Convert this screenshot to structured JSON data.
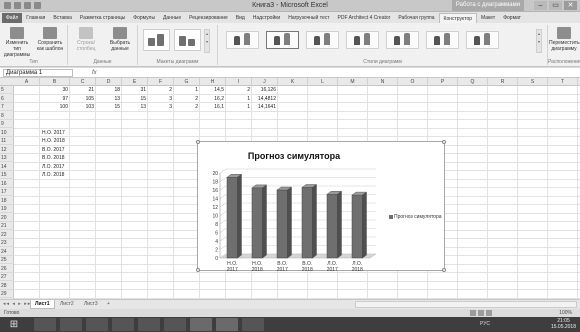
{
  "window": {
    "title": "Книга3 - Microsoft Excel",
    "context_title": "Работа с диаграммами",
    "controls": [
      "–",
      "▭",
      "✕"
    ]
  },
  "ribbon_tabs": [
    "Файл",
    "Главная",
    "Вставка",
    "Разметка страницы",
    "Формулы",
    "Данные",
    "Рецензирование",
    "Вид",
    "Надстройки",
    "Нагрузочный тест",
    "PDF Architect 4 Creator",
    "Рабочая группа",
    "Конструктор",
    "Макет",
    "Формат"
  ],
  "active_tab": "Конструктор",
  "ribbon": {
    "change_type": "Изменить тип диаграммы",
    "save_template": "Сохранить как шаблон",
    "type_group": "Тип",
    "row_col": "Строка/столбец",
    "select_data": "Выбрать данные",
    "data_group": "Данные",
    "layouts_group": "Макеты диаграмм",
    "styles_group": "Стили диаграмм",
    "move_chart": "Переместить диаграмму",
    "location_group": "Расположение"
  },
  "formula_bar": {
    "name_box": "Диаграмма 1",
    "fx": "fx",
    "content": ""
  },
  "columns": [
    "A",
    "B",
    "C",
    "D",
    "E",
    "F",
    "G",
    "H",
    "I",
    "J",
    "K",
    "L",
    "M",
    "N",
    "O",
    "P",
    "Q",
    "R",
    "S",
    "T",
    "U"
  ],
  "rows": [
    "5",
    "6",
    "7",
    "8",
    "9",
    "10",
    "11",
    "12",
    "13",
    "14",
    "15",
    "16",
    "17",
    "18",
    "19",
    "20",
    "21",
    "22",
    "23",
    "24",
    "25",
    "26",
    "27",
    "28",
    "29"
  ],
  "cells": {
    "r5": [
      "30",
      "21",
      "18",
      "31",
      "2",
      "1",
      "14,5",
      "2",
      "16,126"
    ],
    "r6": [
      "97",
      "105",
      "13",
      "15",
      "3",
      "2",
      "16,2",
      "1",
      "14,4812"
    ],
    "r7": [
      "100",
      "103",
      "15",
      "13",
      "3",
      "2",
      "16,1",
      "1",
      "14,1641"
    ],
    "b_labels": [
      "Н.О. 2017",
      "Н.О. 2018",
      "В.О. 2017",
      "В.О. 2018",
      "Л.О. 2017",
      "Л.О. 2018"
    ]
  },
  "chart_data": {
    "type": "bar",
    "title": "Прогноз симулятора",
    "categories": [
      "Н.О. 2017",
      "Н.О. 2018",
      "В.О. 2017",
      "В.О. 2018",
      "Л.О. 2017",
      "Л.О. 2018"
    ],
    "category_lines": [
      [
        "Н.О.",
        "2017"
      ],
      [
        "Н.О.",
        "2018"
      ],
      [
        "В.О.",
        "2017"
      ],
      [
        "В.О.",
        "2018"
      ],
      [
        "Л.О.",
        "2017"
      ],
      [
        "Л.О.",
        "2018"
      ]
    ],
    "series": [
      {
        "name": "Прогноз симулятора",
        "values": [
          19,
          16.5,
          16,
          16.6,
          15,
          14.8
        ]
      }
    ],
    "ylim": [
      0,
      20
    ],
    "yticks": [
      "0",
      "2",
      "4",
      "6",
      "8",
      "10",
      "12",
      "14",
      "16",
      "18",
      "20"
    ],
    "legend": "right",
    "grid": true,
    "bar_color": "#6f6f6f"
  },
  "sheets": [
    "Лист1",
    "Лист2",
    "Лист3"
  ],
  "active_sheet": "Лист1",
  "status": {
    "ready": "Готово",
    "zoom": "100%"
  },
  "taskbar": {
    "tray_lang": "РУС",
    "time": "21:05",
    "date": "15.05.2018"
  }
}
